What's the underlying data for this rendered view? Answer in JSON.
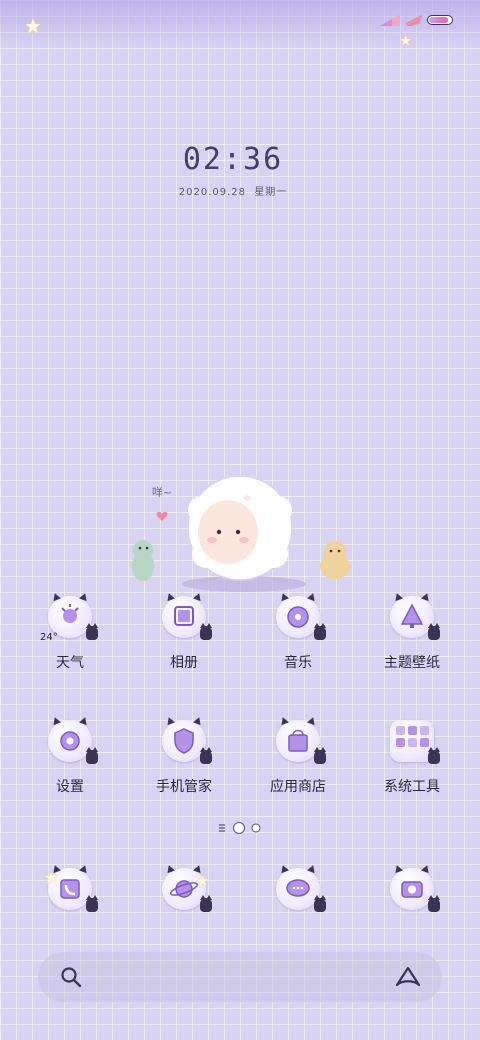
{
  "status_bar": {
    "battery_level": 0.92
  },
  "clock": {
    "time": "02:36",
    "date": "2020.09.28",
    "weekday": "星期一"
  },
  "apps": {
    "row1": [
      {
        "label": "天气",
        "icon": "weather-icon",
        "badge": "24°"
      },
      {
        "label": "相册",
        "icon": "gallery-icon"
      },
      {
        "label": "音乐",
        "icon": "music-icon"
      },
      {
        "label": "主题壁纸",
        "icon": "theme-icon"
      }
    ],
    "row2": [
      {
        "label": "设置",
        "icon": "settings-icon"
      },
      {
        "label": "手机管家",
        "icon": "security-icon"
      },
      {
        "label": "应用商店",
        "icon": "app-store-icon"
      },
      {
        "label": "系统工具",
        "icon": "system-tools-folder-icon"
      }
    ],
    "dock": [
      {
        "icon": "phone-icon"
      },
      {
        "icon": "browser-icon"
      },
      {
        "icon": "messages-icon"
      },
      {
        "icon": "camera-icon"
      }
    ]
  },
  "colors": {
    "background": "#d8d3f0",
    "accent": "#9b7fe0",
    "text": "#2b2740"
  }
}
